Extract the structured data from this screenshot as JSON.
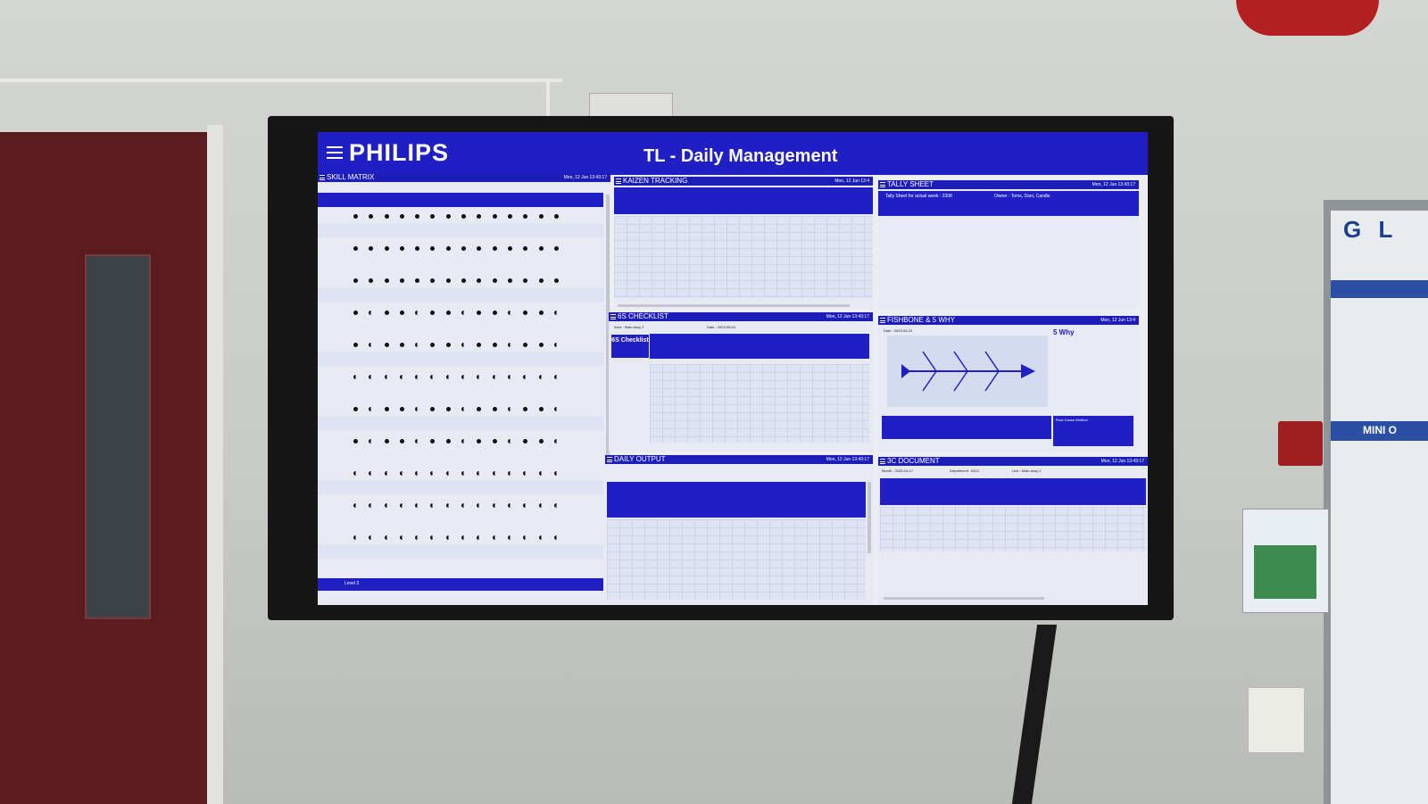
{
  "dashboard": {
    "brand": "PHILIPS",
    "title": "TL - Daily Management"
  },
  "panels": {
    "skill_matrix": {
      "title": "SKILL MATRIX",
      "timestamp": "Mon, 12 Jun 13:43:17"
    },
    "kaizen_tracking": {
      "title": "KAIZEN TRACKING",
      "timestamp": "Mon, 12 Jun 13:4"
    },
    "tally_sheet": {
      "title": "TALLY SHEET",
      "timestamp": "Mon, 12 Jun 13:43:17",
      "sub_label": "Tally Sheet for actual week : 2308",
      "owner": "Owner : Toms, Dani, Candle"
    },
    "checklist_6s": {
      "title": "6S CHECKLIST",
      "timestamp": "Mon, 12 Jun 13:43:17",
      "area": "Area : Main Assy 2",
      "date": "Date : 2023-06-01",
      "tag": "6S Checklist"
    },
    "fishbone": {
      "title": "FISHBONE & 5 WHY",
      "timestamp": "Mon, 12 Jun 13:4",
      "date": "Date : 2023-05-10",
      "why_title": "5 Why",
      "root_cause": "Root Cause Method"
    },
    "daily_output": {
      "title": "DAILY OUTPUT",
      "timestamp": "Mon, 12 Jun 13:43:17"
    },
    "doc_3c": {
      "title": "3C DOCUMENT",
      "timestamp": "Mon, 12 Jun 13:43:17",
      "month": "Month : 2023-04-17",
      "department": "Department : MCC",
      "line": "Line : Main Assy 2"
    }
  },
  "skill_matrix": {
    "rows": [
      {
        "dots": "full"
      },
      {
        "dots": "full"
      },
      {
        "dots": "full"
      },
      {
        "dots": "mixed"
      },
      {
        "dots": "mixed"
      },
      {
        "dots": "half"
      },
      {
        "dots": "mixed"
      },
      {
        "dots": "mixed"
      },
      {
        "dots": "half"
      },
      {
        "dots": "half"
      },
      {
        "dots": "half"
      }
    ],
    "footer_label": "Level 3"
  },
  "environment": {
    "board_label": "G L",
    "board_caption": "MINI O",
    "colors": {
      "header_blue": "#1f1fc4",
      "panel_bg": "#e7e9f3",
      "door": "#5a1c1e"
    }
  }
}
